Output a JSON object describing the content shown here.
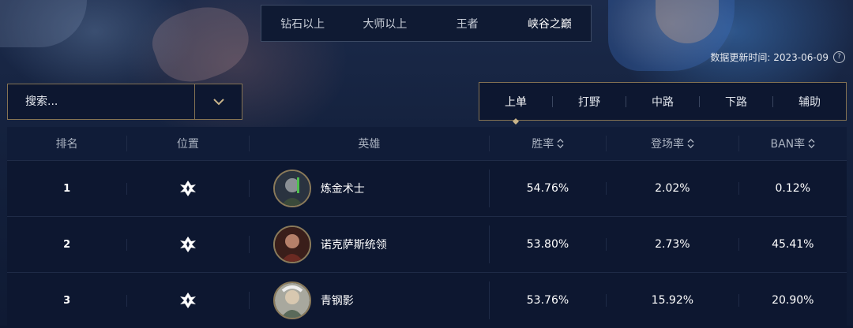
{
  "tier_tabs": [
    "钻石以上",
    "大师以上",
    "王者",
    "峡谷之巅"
  ],
  "active_tier": "峡谷之巅",
  "update_info": "数据更新时间: 2023-06-09",
  "search": {
    "placeholder": "搜索..."
  },
  "position_tabs": [
    "上单",
    "打野",
    "中路",
    "下路",
    "辅助"
  ],
  "active_position": "上单",
  "table": {
    "headers": {
      "rank": "排名",
      "position": "位置",
      "hero": "英雄",
      "winrate": "胜率",
      "pickrate": "登场率",
      "banrate": "BAN率"
    },
    "rows": [
      {
        "rank": "1",
        "position_icon": "top-lane-icon",
        "hero": "炼金术士",
        "winrate": "54.76%",
        "pickrate": "2.02%",
        "banrate": "0.12%"
      },
      {
        "rank": "2",
        "position_icon": "top-lane-icon",
        "hero": "诺克萨斯统领",
        "winrate": "53.80%",
        "pickrate": "2.73%",
        "banrate": "45.41%"
      },
      {
        "rank": "3",
        "position_icon": "top-lane-icon",
        "hero": "青钢影",
        "winrate": "53.76%",
        "pickrate": "15.92%",
        "banrate": "20.90%"
      }
    ]
  },
  "colors": {
    "accent_gold": "#857353",
    "background": "#0d1730",
    "text": "#ffffff"
  }
}
